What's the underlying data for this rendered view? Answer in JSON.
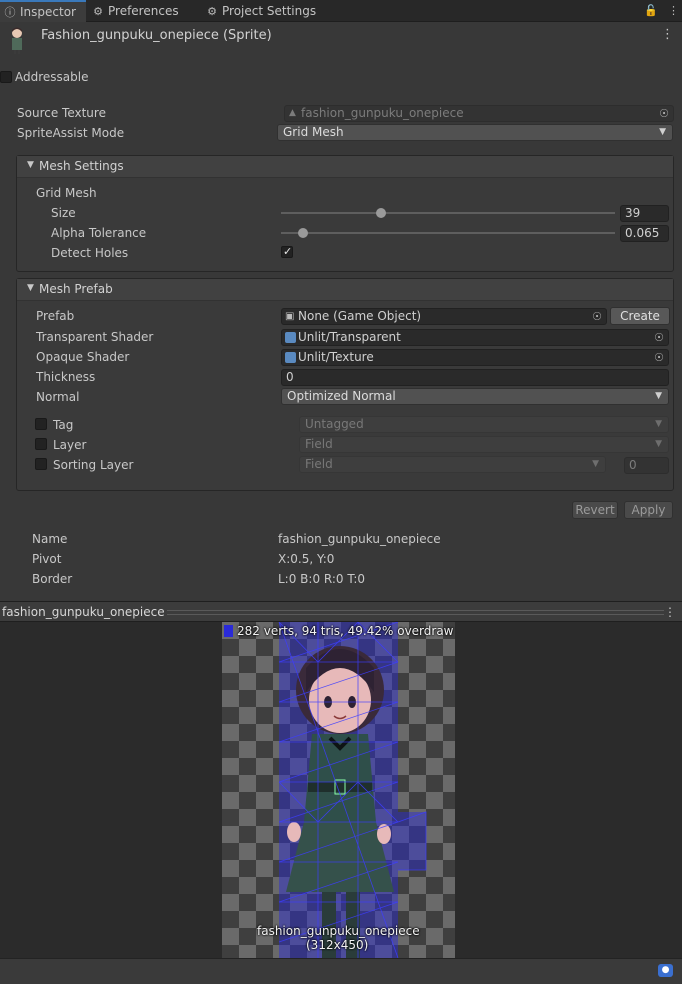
{
  "tabs": [
    {
      "label": "Inspector",
      "icon": "info-icon"
    },
    {
      "label": "Preferences",
      "icon": "gear-icon"
    },
    {
      "label": "Project Settings",
      "icon": "gear-icon"
    }
  ],
  "asset": {
    "title": "Fashion_gunpuku_onepiece (Sprite)"
  },
  "addressable": {
    "label": "Addressable",
    "checked": false
  },
  "source_texture": {
    "label": "Source Texture",
    "value": "fashion_gunpuku_onepiece"
  },
  "sprite_assist": {
    "label": "SpriteAssist Mode",
    "value": "Grid Mesh"
  },
  "mesh_settings": {
    "title": "Mesh Settings",
    "grid_mesh": "Grid Mesh",
    "size": {
      "label": "Size",
      "value": "39",
      "fraction": 0.3
    },
    "alpha": {
      "label": "Alpha Tolerance",
      "value": "0.065",
      "fraction": 0.065
    },
    "detect_holes": {
      "label": "Detect Holes",
      "checked": true
    }
  },
  "mesh_prefab": {
    "title": "Mesh Prefab",
    "prefab": {
      "label": "Prefab",
      "value": "None (Game Object)",
      "button": "Create"
    },
    "transparent_shader": {
      "label": "Transparent Shader",
      "value": "Unlit/Transparent"
    },
    "opaque_shader": {
      "label": "Opaque Shader",
      "value": "Unlit/Texture"
    },
    "thickness": {
      "label": "Thickness",
      "value": "0"
    },
    "normal": {
      "label": "Normal",
      "value": "Optimized Normal"
    },
    "tag": {
      "label": "Tag",
      "value": "Untagged"
    },
    "layer": {
      "label": "Layer",
      "value": "Field"
    },
    "sorting_layer": {
      "label": "Sorting Layer",
      "value": "Field",
      "order": "0"
    }
  },
  "buttons": {
    "revert": "Revert",
    "apply": "Apply"
  },
  "info": {
    "name": {
      "label": "Name",
      "value": "fashion_gunpuku_onepiece"
    },
    "pivot": {
      "label": "Pivot",
      "value": "X:0.5, Y:0"
    },
    "border": {
      "label": "Border",
      "value": "L:0 B:0 R:0 T:0"
    }
  },
  "preview": {
    "title": "fashion_gunpuku_onepiece",
    "stats": "282 verts, 94 tris, 49.42% overdraw",
    "caption_name": "fashion_gunpuku_onepiece",
    "caption_size": "(312x450)"
  },
  "colors": {
    "accent": "#3a79bb",
    "mesh": "#2a2ad8"
  }
}
